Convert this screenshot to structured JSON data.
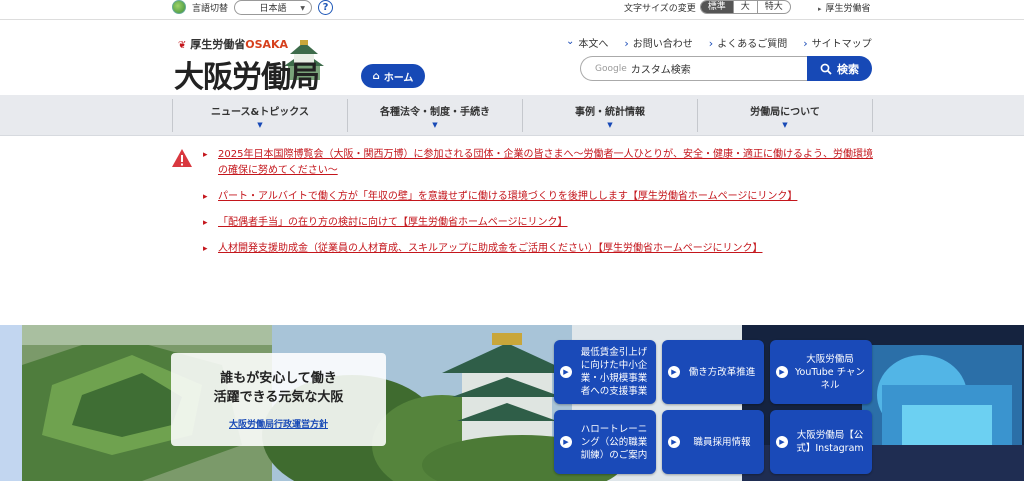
{
  "topbar": {
    "lang_label": "言語切替",
    "lang_value": "日本語",
    "help_label": "?",
    "font_size_label": "文字サイズの変更",
    "font_sizes": [
      "標準",
      "大",
      "特大"
    ],
    "mhlw_link": "厚生労働省"
  },
  "header": {
    "logo_ministry": "厚生労働省",
    "logo_osaka": "OSAKA",
    "logo_title": "大阪労働局",
    "home_label": "ホーム",
    "links": [
      "本文へ",
      "お問い合わせ",
      "よくあるご質問",
      "サイトマップ"
    ],
    "search_brand": "Google",
    "search_placeholder": "カスタム検索",
    "search_button": "検索"
  },
  "nav": {
    "items": [
      "ニュース&トピックス",
      "各種法令・制度・手続き",
      "事例・統計情報",
      "労働局について"
    ]
  },
  "notices": [
    "2025年日本国際博覧会（大阪・関西万博）に参加される団体・企業の皆さまへ～労働者一人ひとりが、安全・健康・適正に働けるよう、労働環境の確保に努めてください～",
    "パート・アルバイトで働く方が「年収の壁」を意識せずに働ける環境づくりを後押しします【厚生労働省ホームページにリンク】",
    "「配偶者手当」の在り方の検討に向けて【厚生労働省ホームページにリンク】",
    "人材開発支援助成金（従業員の人材育成、スキルアップに助成金をご活用ください）【厚生労働省ホームページにリンク】"
  ],
  "hero": {
    "line1": "誰もが安心して働き",
    "line2": "活躍できる元気な大阪",
    "link": "大阪労働局行政運営方針",
    "tiles": [
      "最低賃金引上げに向けた中小企業・小規模事業者への支援事業",
      "働き方改革推進",
      "大阪労働局YouTube チャンネル",
      "ハロートレーニング（公的職業訓練）のご案内",
      "職員採用情報",
      "大阪労働局【公式】Instagram"
    ]
  },
  "colors": {
    "brand_blue": "#1749b6",
    "notice_red": "#c4161c",
    "nav_bg": "#e8eaee"
  }
}
